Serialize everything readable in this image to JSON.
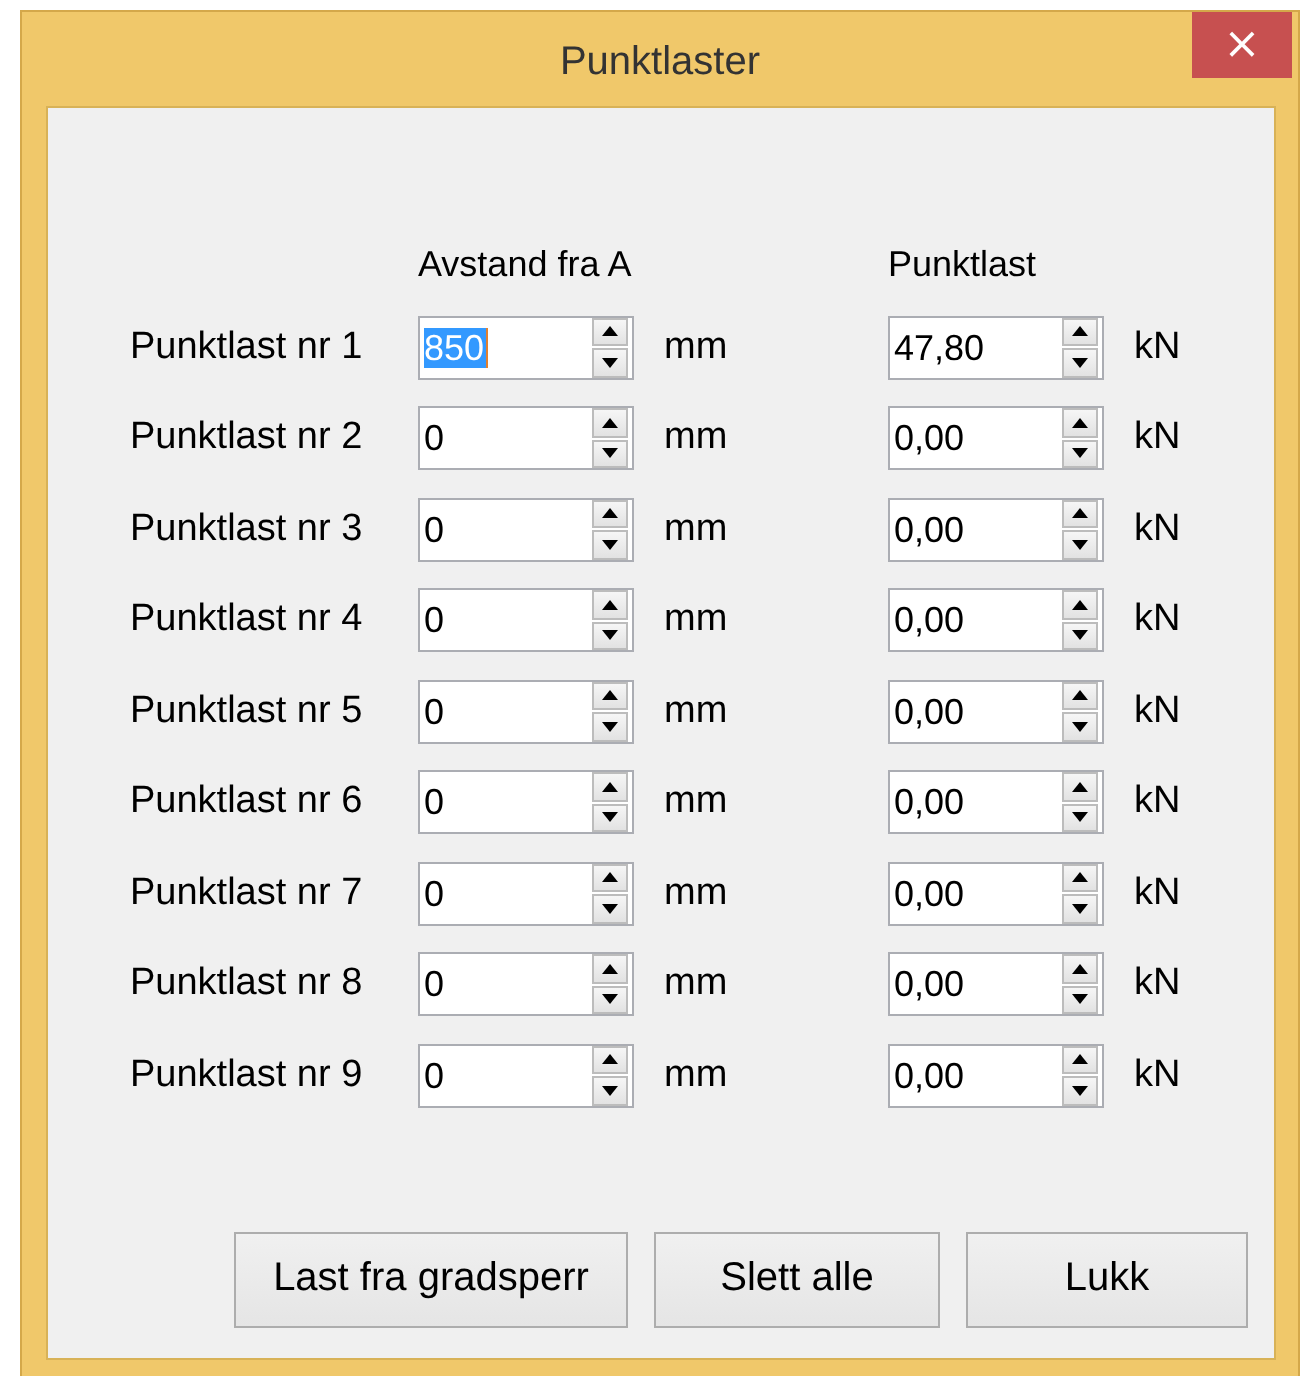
{
  "window": {
    "title": "Punktlaster",
    "close": "×"
  },
  "headers": {
    "distance": "Avstand fra A",
    "load": "Punktlast"
  },
  "rows": [
    {
      "label": "Punktlast nr 1",
      "distance": {
        "value": "850",
        "selected": true
      },
      "distance_unit": "mm",
      "load": {
        "value": "47,80",
        "selected": false
      },
      "load_unit": "kN"
    },
    {
      "label": "Punktlast nr 2",
      "distance": {
        "value": "0",
        "selected": false
      },
      "distance_unit": "mm",
      "load": {
        "value": "0,00",
        "selected": false
      },
      "load_unit": "kN"
    },
    {
      "label": "Punktlast nr 3",
      "distance": {
        "value": "0",
        "selected": false
      },
      "distance_unit": "mm",
      "load": {
        "value": "0,00",
        "selected": false
      },
      "load_unit": "kN"
    },
    {
      "label": "Punktlast nr 4",
      "distance": {
        "value": "0",
        "selected": false
      },
      "distance_unit": "mm",
      "load": {
        "value": "0,00",
        "selected": false
      },
      "load_unit": "kN"
    },
    {
      "label": "Punktlast nr 5",
      "distance": {
        "value": "0",
        "selected": false
      },
      "distance_unit": "mm",
      "load": {
        "value": "0,00",
        "selected": false
      },
      "load_unit": "kN"
    },
    {
      "label": "Punktlast nr 6",
      "distance": {
        "value": "0",
        "selected": false
      },
      "distance_unit": "mm",
      "load": {
        "value": "0,00",
        "selected": false
      },
      "load_unit": "kN"
    },
    {
      "label": "Punktlast nr 7",
      "distance": {
        "value": "0",
        "selected": false
      },
      "distance_unit": "mm",
      "load": {
        "value": "0,00",
        "selected": false
      },
      "load_unit": "kN"
    },
    {
      "label": "Punktlast nr 8",
      "distance": {
        "value": "0",
        "selected": false
      },
      "distance_unit": "mm",
      "load": {
        "value": "0,00",
        "selected": false
      },
      "load_unit": "kN"
    },
    {
      "label": "Punktlast nr 9",
      "distance": {
        "value": "0",
        "selected": false
      },
      "distance_unit": "mm",
      "load": {
        "value": "0,00",
        "selected": false
      },
      "load_unit": "kN"
    }
  ],
  "buttons": [
    "Last fra gradsperr",
    "Slett alle",
    "Lukk"
  ]
}
